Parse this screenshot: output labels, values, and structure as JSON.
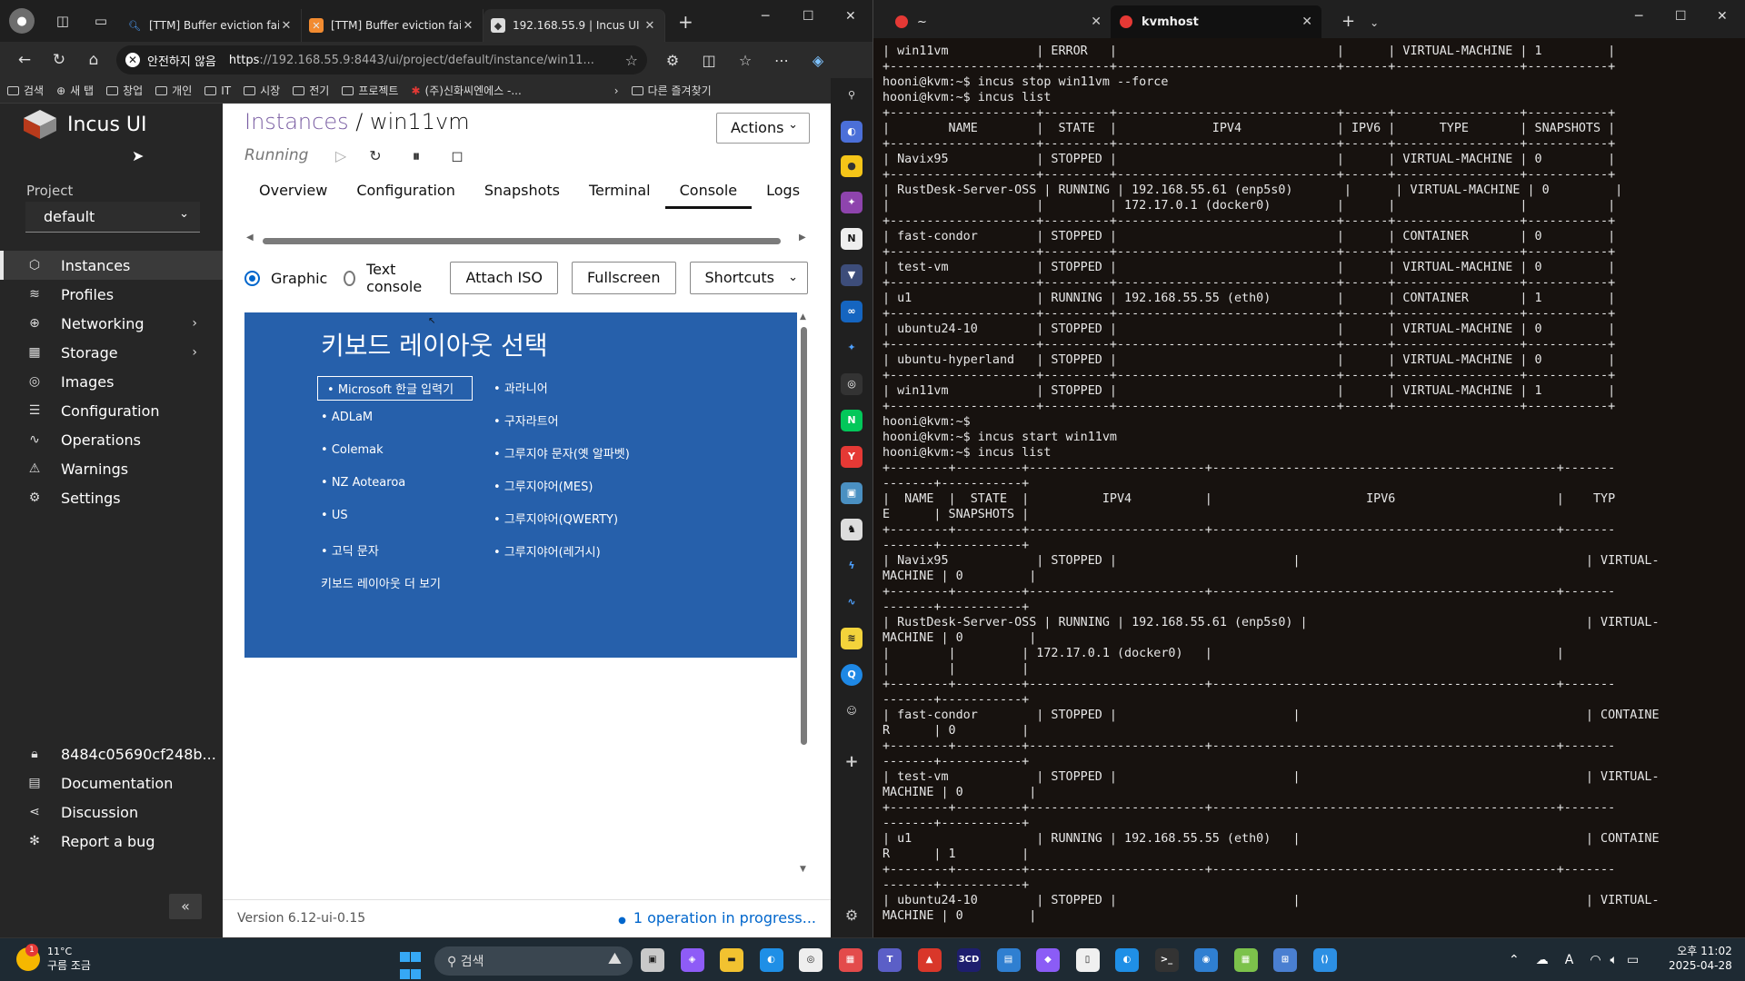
{
  "browser": {
    "profile_icon": "profile-avatar-icon",
    "tabs": [
      {
        "title": "[TTM] Buffer eviction failed",
        "favicon": "search-favicon",
        "active": false
      },
      {
        "title": "[TTM] Buffer eviction failed",
        "favicon": "orange-x-favicon",
        "active": false
      },
      {
        "title": "192.168.55.9 | Incus UI",
        "favicon": "incus-favicon",
        "active": true
      }
    ],
    "security_warning": "안전하지 않음",
    "url_prefix": "https",
    "url_rest": "://192.168.55.9:8443/ui/project/default/instance/win11...",
    "bookmarks": [
      "검색",
      "새 탭",
      "창업",
      "개인",
      "IT",
      "시장",
      "전기",
      "프로젝트",
      "(주)신화씨엔에스 -..."
    ],
    "other_bookmarks": "다른 즐겨찾기"
  },
  "incus": {
    "app_name": "Incus UI",
    "project_label": "Project",
    "project_value": "default",
    "nav": [
      {
        "label": "Instances",
        "icon": "instances-icon",
        "active": true,
        "has_arrow": false
      },
      {
        "label": "Profiles",
        "icon": "profiles-icon",
        "active": false,
        "has_arrow": false
      },
      {
        "label": "Networking",
        "icon": "networking-icon",
        "active": false,
        "has_arrow": true
      },
      {
        "label": "Storage",
        "icon": "storage-icon",
        "active": false,
        "has_arrow": true
      },
      {
        "label": "Images",
        "icon": "images-icon",
        "active": false,
        "has_arrow": false
      },
      {
        "label": "Configuration",
        "icon": "configuration-icon",
        "active": false,
        "has_arrow": false
      },
      {
        "label": "Operations",
        "icon": "operations-icon",
        "active": false,
        "has_arrow": false
      },
      {
        "label": "Warnings",
        "icon": "warnings-icon",
        "active": false,
        "has_arrow": false
      },
      {
        "label": "Settings",
        "icon": "settings-icon",
        "active": false,
        "has_arrow": false
      }
    ],
    "bottom_nav": [
      {
        "label": "8484c05690cf248b...",
        "icon": "lock-icon"
      },
      {
        "label": "Documentation",
        "icon": "documentation-icon"
      },
      {
        "label": "Discussion",
        "icon": "discussion-icon"
      },
      {
        "label": "Report a bug",
        "icon": "bug-icon"
      }
    ],
    "breadcrumb_link": "Instances",
    "breadcrumb_sep": " / ",
    "instance_name": "win11vm",
    "status": "Running",
    "actions_label": "Actions",
    "tabs": [
      "Overview",
      "Configuration",
      "Snapshots",
      "Terminal",
      "Console",
      "Logs"
    ],
    "active_tab": "Console",
    "console_modes": [
      {
        "label": "Graphic",
        "checked": true
      },
      {
        "label": "Text console",
        "checked": false
      }
    ],
    "buttons": {
      "attach_iso": "Attach ISO",
      "fullscreen": "Fullscreen",
      "shortcuts": "Shortcuts"
    },
    "console_screen": {
      "title": "키보드 레이아웃 선택",
      "left_col": [
        "Microsoft 한글 입력기",
        "ADLaM",
        "Colemak",
        "NZ Aotearoa",
        "US",
        "고딕 문자"
      ],
      "right_col": [
        "과라니어",
        "구자라트어",
        "그루지야 문자(옛 알파벳)",
        "그루지야어(MES)",
        "그루지야어(QWERTY)",
        "그루지야어(레거시)"
      ],
      "more": "키보드 레이아웃 더 보기",
      "bg_color": "#2660ab"
    },
    "version": "Version 6.12-ui-0.15",
    "operations": "1 operation in progress..."
  },
  "terminal": {
    "tabs": [
      {
        "label": "~",
        "active": false
      },
      {
        "label": "kvmhost",
        "active": true
      }
    ],
    "lines": [
      "| win11vm            | ERROR   |                              |      | VIRTUAL-MACHINE | 1         |",
      "+--------------------+---------+------------------------------+------+-----------------+-----------+",
      "hooni@kvm:~$ incus stop win11vm --force",
      "hooni@kvm:~$ incus list",
      "+--------------------+---------+------------------------------+------+-----------------+-----------+",
      "|        NAME        |  STATE  |             IPV4             | IPV6 |      TYPE       | SNAPSHOTS |",
      "+--------------------+---------+------------------------------+------+-----------------+-----------+",
      "| Navix95            | STOPPED |                              |      | VIRTUAL-MACHINE | 0         |",
      "+--------------------+---------+------------------------------+------+-----------------+-----------+",
      "| RustDesk-Server-OSS | RUNNING | 192.168.55.61 (enp5s0)       |      | VIRTUAL-MACHINE | 0         |",
      "|                    |         | 172.17.0.1 (docker0)         |      |                 |           |",
      "+--------------------+---------+------------------------------+------+-----------------+-----------+",
      "| fast-condor        | STOPPED |                              |      | CONTAINER       | 0         |",
      "+--------------------+---------+------------------------------+------+-----------------+-----------+",
      "| test-vm            | STOPPED |                              |      | VIRTUAL-MACHINE | 0         |",
      "+--------------------+---------+------------------------------+------+-----------------+-----------+",
      "| u1                 | RUNNING | 192.168.55.55 (eth0)         |      | CONTAINER       | 1         |",
      "+--------------------+---------+------------------------------+------+-----------------+-----------+",
      "| ubuntu24-10        | STOPPED |                              |      | VIRTUAL-MACHINE | 0         |",
      "+--------------------+---------+------------------------------+------+-----------------+-----------+",
      "| ubuntu-hyperland   | STOPPED |                              |      | VIRTUAL-MACHINE | 0         |",
      "+--------------------+---------+------------------------------+------+-----------------+-----------+",
      "| win11vm            | STOPPED |                              |      | VIRTUAL-MACHINE | 1         |",
      "+--------------------+---------+------------------------------+------+-----------------+-----------+",
      "hooni@kvm:~$",
      "hooni@kvm:~$ incus start win11vm",
      "hooni@kvm:~$ incus list",
      "+--------+---------+------------------------+-----------------------------------------------+-------",
      "-------+-----------+",
      "|  NAME  |  STATE  |          IPV4          |                     IPV6                      |    TYP",
      "E      | SNAPSHOTS |",
      "+--------+---------+------------------------+-----------------------------------------------+-------",
      "-------+-----------+",
      "| Navix95            | STOPPED |                        |                                       | VIRTUAL-",
      "MACHINE | 0         |",
      "+--------+---------+------------------------+-----------------------------------------------+-------",
      "-------+-----------+",
      "| RustDesk-Server-OSS | RUNNING | 192.168.55.61 (enp5s0) |                                      | VIRTUAL-",
      "MACHINE | 0         |",
      "|        |         | 172.17.0.1 (docker0)   |                                               |",
      "|        |         |",
      "+--------+---------+------------------------+-----------------------------------------------+-------",
      "-------+-----------+",
      "| fast-condor        | STOPPED |                        |                                       | CONTAINE",
      "R      | 0         |",
      "+--------+---------+------------------------+-----------------------------------------------+-------",
      "-------+-----------+",
      "| test-vm            | STOPPED |                        |                                       | VIRTUAL-",
      "MACHINE | 0         |",
      "+--------+---------+------------------------+-----------------------------------------------+-------",
      "-------+-----------+",
      "| u1                 | RUNNING | 192.168.55.55 (eth0)   |                                       | CONTAINE",
      "R      | 1         |",
      "+--------+---------+------------------------+-----------------------------------------------+-------",
      "-------+-----------+",
      "| ubuntu24-10        | STOPPED |                        |                                       | VIRTUAL-",
      "MACHINE | 0         |"
    ]
  },
  "taskbar": {
    "temperature": "11°C",
    "weather_text": "구름 조금",
    "weather_badge": "1",
    "search_placeholder": "검색",
    "apps": [
      "file-explorer",
      "copilot",
      "folder",
      "edge",
      "chrome",
      "store",
      "teams",
      "app-red",
      "3cd",
      "photos",
      "app-purple",
      "notepad",
      "edge-dev",
      "terminal",
      "app-blue",
      "app-green",
      "network",
      "vscode"
    ],
    "time": "오후 11:02",
    "date": "2025-04-28"
  }
}
